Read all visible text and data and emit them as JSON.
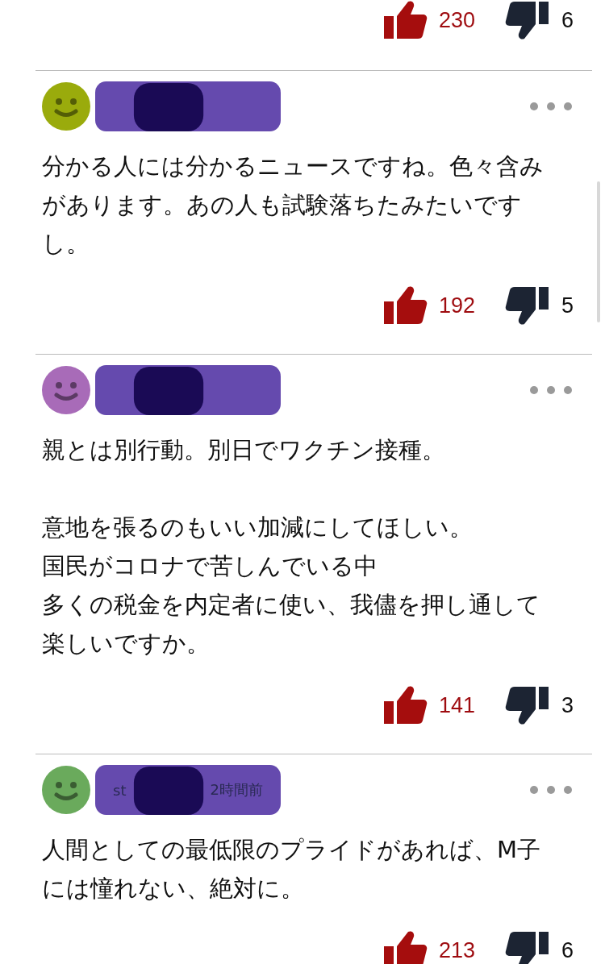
{
  "top_votes": {
    "up": "230",
    "down": "6"
  },
  "comments": [
    {
      "avatar": {
        "color": "#9aab0c"
      },
      "paragraphs": [
        [
          "分かる人には分かるニュースですね。色々含みがあります。あの人も試験落ちたみたいですし。"
        ]
      ],
      "up": "192",
      "down": "5"
    },
    {
      "avatar": {
        "color": "#a86bb8"
      },
      "paragraphs": [
        [
          "親とは別行動。別日でワクチン接種。"
        ],
        [
          "意地を張るのもいい加減にしてほしい。",
          "国民がコロナで苦しんでいる中",
          "多くの税金を内定者に使い、我儘を押し通して楽しいですか。"
        ]
      ],
      "up": "141",
      "down": "3"
    },
    {
      "avatar": {
        "color": "#6aaa5c"
      },
      "header": {
        "name": "st",
        "time": "2時間前"
      },
      "paragraphs": [
        [
          "人間としての最低限のプライドがあれば、M子には憧れない、絶対に。"
        ]
      ],
      "up": "213",
      "down": "6"
    }
  ]
}
